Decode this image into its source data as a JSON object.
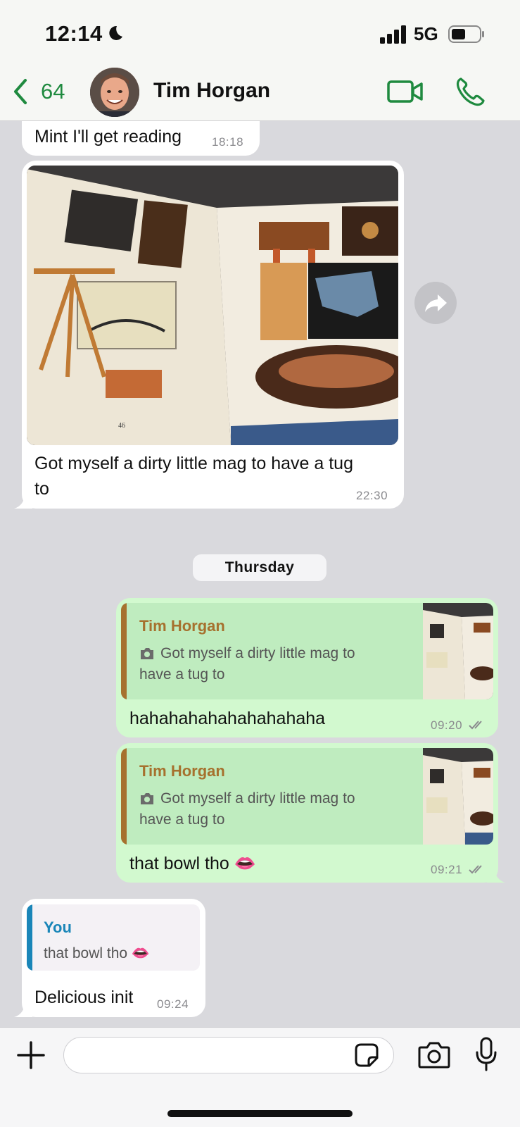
{
  "status_bar": {
    "time": "12:14",
    "network": "5G"
  },
  "header": {
    "back_count": "64",
    "contact_name": "Tim Horgan",
    "accent_color": "#1f8a3f"
  },
  "messages": [
    {
      "direction": "in",
      "text": "Mint I'll get reading",
      "time": "18:18"
    },
    {
      "direction": "in",
      "type": "photo",
      "caption": "Got myself a dirty little mag to have a tug to",
      "caption_line1": "Got myself a dirty little mag to have a tug",
      "caption_line2": "to",
      "time": "22:30"
    },
    {
      "direction": "out",
      "reply_to": {
        "name": "Tim Horgan",
        "text_line1": "Got myself a dirty little mag to",
        "text_line2": "have a tug to"
      },
      "text": "hahahahahahahahahaha",
      "time": "09:20"
    },
    {
      "direction": "out",
      "reply_to": {
        "name": "Tim Horgan",
        "text_line1": "Got myself a dirty little mag to",
        "text_line2": "have a tug to"
      },
      "text": "that bowl tho 👄",
      "time": "09:21"
    },
    {
      "direction": "in",
      "reply_to": {
        "name": "You",
        "text": "that bowl tho 👄"
      },
      "text": "Delicious init",
      "time": "09:24"
    }
  ],
  "day_separator": "Thursday",
  "composer": {
    "placeholder": ""
  },
  "colors": {
    "outgoing_bubble": "#d2f9cf",
    "incoming_bubble": "#ffffff",
    "quote_name_tim": "#a6712e",
    "quote_name_you": "#1a86b8"
  }
}
